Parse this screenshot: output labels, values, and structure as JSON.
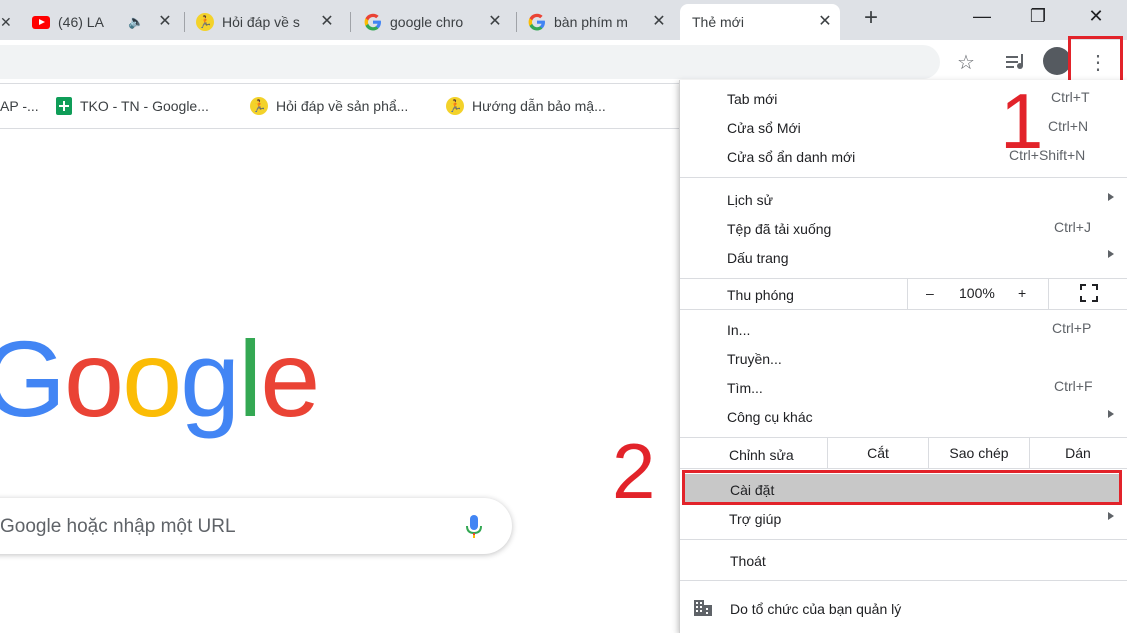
{
  "tabs": [
    {
      "title": "(46) LA",
      "icon": "youtube-icon",
      "audio": true
    },
    {
      "title": "Hỏi đáp về s",
      "icon": "runner-icon"
    },
    {
      "title": "google chro",
      "icon": "google-g-icon"
    },
    {
      "title": "bàn phím m",
      "icon": "google-g-icon"
    },
    {
      "title": "Thẻ mới",
      "icon": "",
      "active": true
    }
  ],
  "new_tab_symbol": "+",
  "window_controls": {
    "minimize": "—",
    "maximize": "❐",
    "close": "✕"
  },
  "bookmarks": [
    {
      "label": "AP -..."
    },
    {
      "label": "TKO - TN - Google...",
      "icon": "sheets-icon"
    },
    {
      "label": "Hỏi đáp về sản phẩ...",
      "icon": "runner-icon"
    },
    {
      "label": "Hướng dẫn bảo mậ...",
      "icon": "runner-icon"
    }
  ],
  "newtab": {
    "logo_letters": [
      "G",
      "o",
      "o",
      "g",
      "l",
      "e"
    ],
    "logo_colors": [
      "#4285f4",
      "#ea4335",
      "#fbbc05",
      "#4285f4",
      "#34a853",
      "#ea4335"
    ],
    "search_placeholder": "Google hoặc nhập một URL"
  },
  "menu": {
    "group1": [
      {
        "label": "Tab mới",
        "shortcut": "Ctrl+T"
      },
      {
        "label": "Cửa sổ Mới",
        "shortcut": "Ctrl+N"
      },
      {
        "label": "Cửa sổ ẩn danh mới",
        "shortcut": "Ctrl+Shift+N"
      }
    ],
    "group2": [
      {
        "label": "Lịch sử",
        "submenu": true
      },
      {
        "label": "Tệp đã tải xuống",
        "shortcut": "Ctrl+J"
      },
      {
        "label": "Dấu trang",
        "submenu": true
      }
    ],
    "zoom": {
      "label": "Thu phóng",
      "minus": "–",
      "value": "100%",
      "plus": "+"
    },
    "group3": [
      {
        "label": "In...",
        "shortcut": "Ctrl+P"
      },
      {
        "label": "Truyền..."
      },
      {
        "label": "Tìm...",
        "shortcut": "Ctrl+F"
      },
      {
        "label": "Công cụ khác",
        "submenu": true
      }
    ],
    "edit": {
      "label": "Chỉnh sửa",
      "cut": "Cắt",
      "copy": "Sao chép",
      "paste": "Dán"
    },
    "settings": "Cài đặt",
    "help": "Trợ giúp",
    "exit": "Thoát",
    "managed": "Do tổ chức của bạn quản lý"
  },
  "annotations": {
    "step1": "1",
    "step2": "2",
    "color": "#e2232a"
  }
}
